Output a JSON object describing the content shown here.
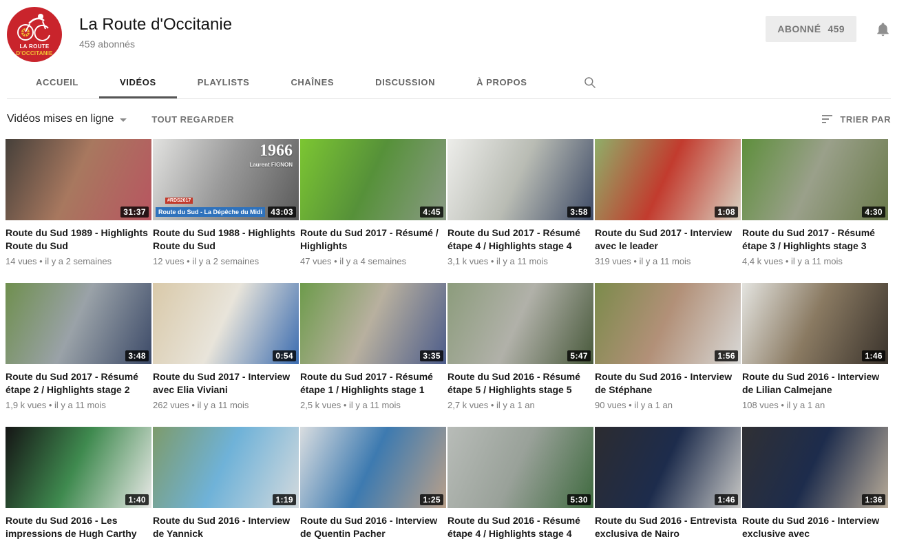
{
  "header": {
    "channel_name": "La Route d'Occitanie",
    "subscribers": "459 abonnés",
    "subscribe_label": "ABONNÉ",
    "subscribe_count": "459",
    "avatar_line1": "LA ROUTE",
    "avatar_line2": "D'OCCITANIE",
    "brand_red": "#c9242c",
    "brand_yellow": "#f2c233"
  },
  "tabs": [
    {
      "label": "ACCUEIL",
      "active": false
    },
    {
      "label": "VIDÉOS",
      "active": true
    },
    {
      "label": "PLAYLISTS",
      "active": false
    },
    {
      "label": "CHAÎNES",
      "active": false
    },
    {
      "label": "DISCUSSION",
      "active": false
    },
    {
      "label": "À PROPOS",
      "active": false
    }
  ],
  "filters": {
    "uploads_label": "Vidéos mises en ligne",
    "watch_all_label": "TOUT REGARDER",
    "sort_by_label": "TRIER PAR"
  },
  "icons": {
    "search": "search-icon",
    "bell": "notification-bell-icon",
    "sort": "sort-lines-icon",
    "caret": "chevron-down-icon"
  },
  "videos": [
    {
      "title": "Route du Sud 1989 - Highlights Route du Sud",
      "views": "14 vues",
      "age": "il y a 2 semaines",
      "duration": "31:37",
      "thumb_colors": [
        "#46403a",
        "#a8785f",
        "#b85560"
      ]
    },
    {
      "title": "Route du Sud 1988 - Highlights Route du Sud",
      "views": "12 vues",
      "age": "il y a 2 semaines",
      "duration": "43:03",
      "thumb_colors": [
        "#e2e2e0",
        "#9a9a9a",
        "#5a5a5a"
      ],
      "overlay": {
        "year": "1966",
        "name": "Laurent FIGNON",
        "banner_tag": "#RDS2017",
        "banner_text": "Route du Sud - La Dépêche du Midi"
      }
    },
    {
      "title": "Route du Sud 2017 - Résumé / Highlights",
      "views": "47 vues",
      "age": "il y a 4 semaines",
      "duration": "4:45",
      "thumb_colors": [
        "#7cc632",
        "#569139",
        "#8a9a85"
      ]
    },
    {
      "title": "Route du Sud 2017 - Résumé étape 4 / Highlights stage 4",
      "views": "3,1 k vues",
      "age": "il y a 11 mois",
      "duration": "3:58",
      "thumb_colors": [
        "#ededea",
        "#b9bcb4",
        "#3d4a66"
      ]
    },
    {
      "title": "Route du Sud 2017 - Interview avec le leader",
      "views": "319 vues",
      "age": "il y a 11 mois",
      "duration": "1:08",
      "thumb_colors": [
        "#8fae69",
        "#c23b2e",
        "#d9d2c2"
      ]
    },
    {
      "title": "Route du Sud 2017 - Résumé étape 3 / Highlights stage 3",
      "views": "4,4 k vues",
      "age": "il y a 11 mois",
      "duration": "4:30",
      "thumb_colors": [
        "#5e8f3c",
        "#9aA08a",
        "#6a7a4a"
      ]
    },
    {
      "title": "Route du Sud 2017 - Résumé étape 2 / Highlights stage 2",
      "views": "1,9 k vues",
      "age": "il y a 11 mois",
      "duration": "3:48",
      "thumb_colors": [
        "#6f8f4e",
        "#9aa2a8",
        "#3c4a68"
      ]
    },
    {
      "title": "Route du Sud 2017 - Interview avec Elia Viviani",
      "views": "262 vues",
      "age": "il y a 11 mois",
      "duration": "0:54",
      "thumb_colors": [
        "#d9c9a9",
        "#e8e4da",
        "#3b6cb0"
      ]
    },
    {
      "title": "Route du Sud 2017 - Résumé étape 1 / Highlights stage 1",
      "views": "2,5 k vues",
      "age": "il y a 11 mois",
      "duration": "3:35",
      "thumb_colors": [
        "#6d9b4b",
        "#b8b09f",
        "#4c5c8a"
      ]
    },
    {
      "title": "Route du Sud 2016 - Résumé étape 5 / Highlights stage 5",
      "views": "2,7 k vues",
      "age": "il y a 1 an",
      "duration": "5:47",
      "thumb_colors": [
        "#8c9c7c",
        "#b1b1a9",
        "#48593b"
      ]
    },
    {
      "title": "Route du Sud 2016 - Interview de Stéphane",
      "views": "90 vues",
      "age": "il y a 1 an",
      "duration": "1:56",
      "thumb_colors": [
        "#7b8b4b",
        "#b29078",
        "#d8d8d6"
      ]
    },
    {
      "title": "Route du Sud 2016 - Interview de Lilian Calmejane",
      "views": "108 vues",
      "age": "il y a 1 an",
      "duration": "1:46",
      "thumb_colors": [
        "#e4e4e0",
        "#8a7a62",
        "#3a332c"
      ]
    },
    {
      "title": "Route du Sud 2016 - Les impressions de Hugh Carthy",
      "views": "",
      "age": "",
      "duration": "1:40",
      "thumb_colors": [
        "#151515",
        "#3f8a4f",
        "#e9e9e7"
      ]
    },
    {
      "title": "Route du Sud 2016 - Interview de Yannick",
      "views": "",
      "age": "",
      "duration": "1:19",
      "thumb_colors": [
        "#7d9b6b",
        "#6fb2d8",
        "#d2d9dd"
      ]
    },
    {
      "title": "Route du Sud 2016 - Interview de Quentin Pacher",
      "views": "",
      "age": "",
      "duration": "1:25",
      "thumb_colors": [
        "#d9dde0",
        "#3d7ab0",
        "#b9a08a"
      ]
    },
    {
      "title": "Route du Sud 2016 - Résumé étape 4 / Highlights stage 4",
      "views": "",
      "age": "",
      "duration": "5:30",
      "thumb_colors": [
        "#b8bcb8",
        "#99a199",
        "#3f6a3f"
      ]
    },
    {
      "title": "Route du Sud 2016 - Entrevista exclusiva de Nairo",
      "views": "",
      "age": "",
      "duration": "1:46",
      "thumb_colors": [
        "#2c2c30",
        "#1d2c4c",
        "#c6c6c4"
      ]
    },
    {
      "title": "Route du Sud 2016 - Interview exclusive avec",
      "views": "",
      "age": "",
      "duration": "1:36",
      "thumb_colors": [
        "#303034",
        "#1d2c4c",
        "#b8ab98"
      ]
    }
  ]
}
